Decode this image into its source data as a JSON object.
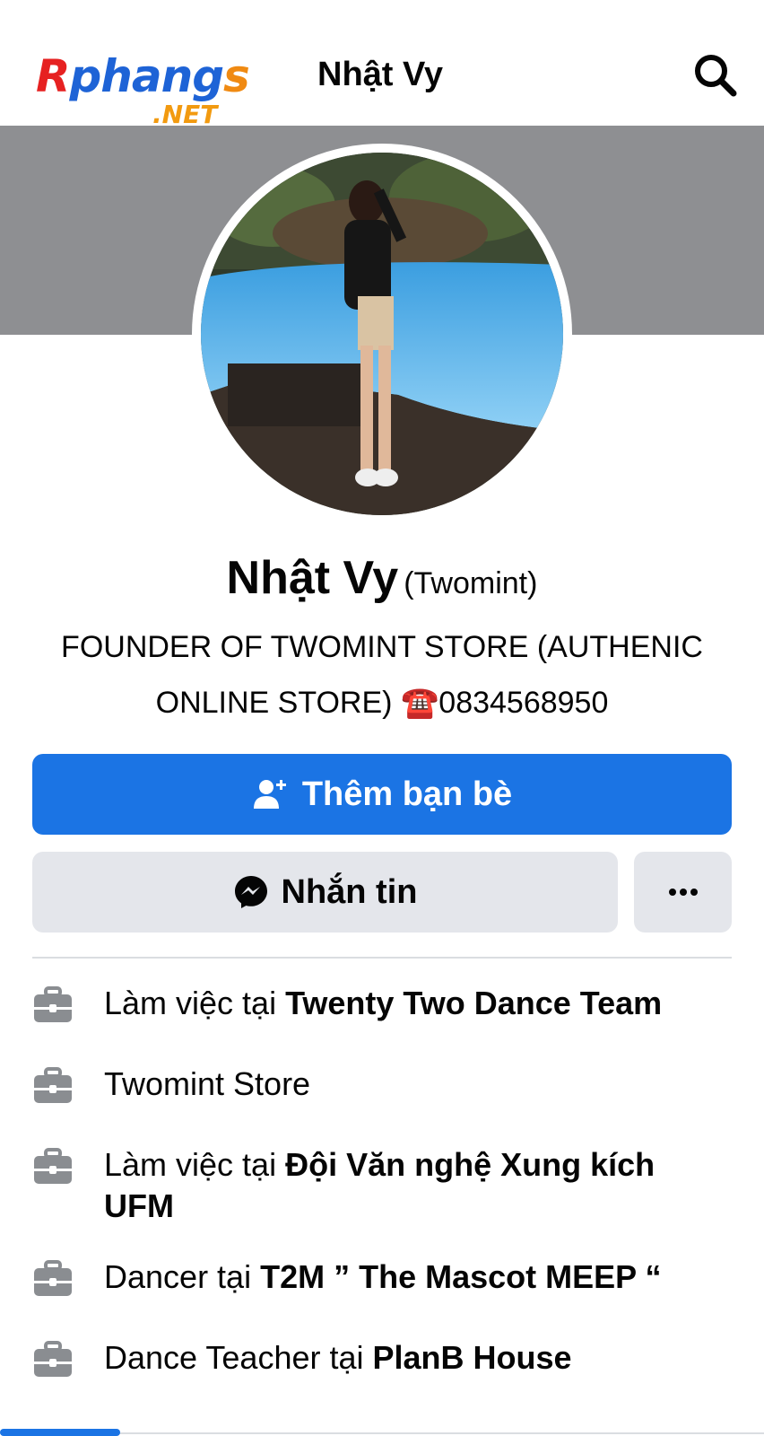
{
  "watermark": {
    "main": [
      "R",
      "phang",
      "s"
    ],
    "sub": ".NET"
  },
  "header": {
    "title": "Nhật Vy"
  },
  "profile": {
    "name": "Nhật Vy",
    "nickname": "(Twomint)",
    "bio_line1": "FOUNDER OF TWOMINT STORE (AUTHENIC",
    "bio_line2_text": "ONLINE STORE) ",
    "bio_phone_icon": "☎️",
    "bio_phone": "0834568950"
  },
  "actions": {
    "add_friend": "Thêm bạn bè",
    "message": "Nhắn tin",
    "more": "more-options"
  },
  "info": [
    {
      "prefix": "Làm việc tại ",
      "bold": "Twenty Two Dance Team",
      "icon": "briefcase-icon"
    },
    {
      "prefix": "Twomint Store",
      "bold": "",
      "icon": "briefcase-icon"
    },
    {
      "prefix": "Làm việc tại ",
      "bold": "Đội Văn nghệ Xung kích UFM",
      "icon": "briefcase-icon"
    },
    {
      "prefix": "Dancer tại ",
      "bold": "T2M ” The Mascot MEEP “",
      "icon": "briefcase-icon"
    },
    {
      "prefix": "Dance Teacher tại ",
      "bold": "PlanB House",
      "icon": "briefcase-icon"
    }
  ],
  "colors": {
    "primary": "#1b74e4",
    "cover": "#8e8f92",
    "secondary_button": "#e4e6eb",
    "icon_gray": "#8a8d91"
  }
}
